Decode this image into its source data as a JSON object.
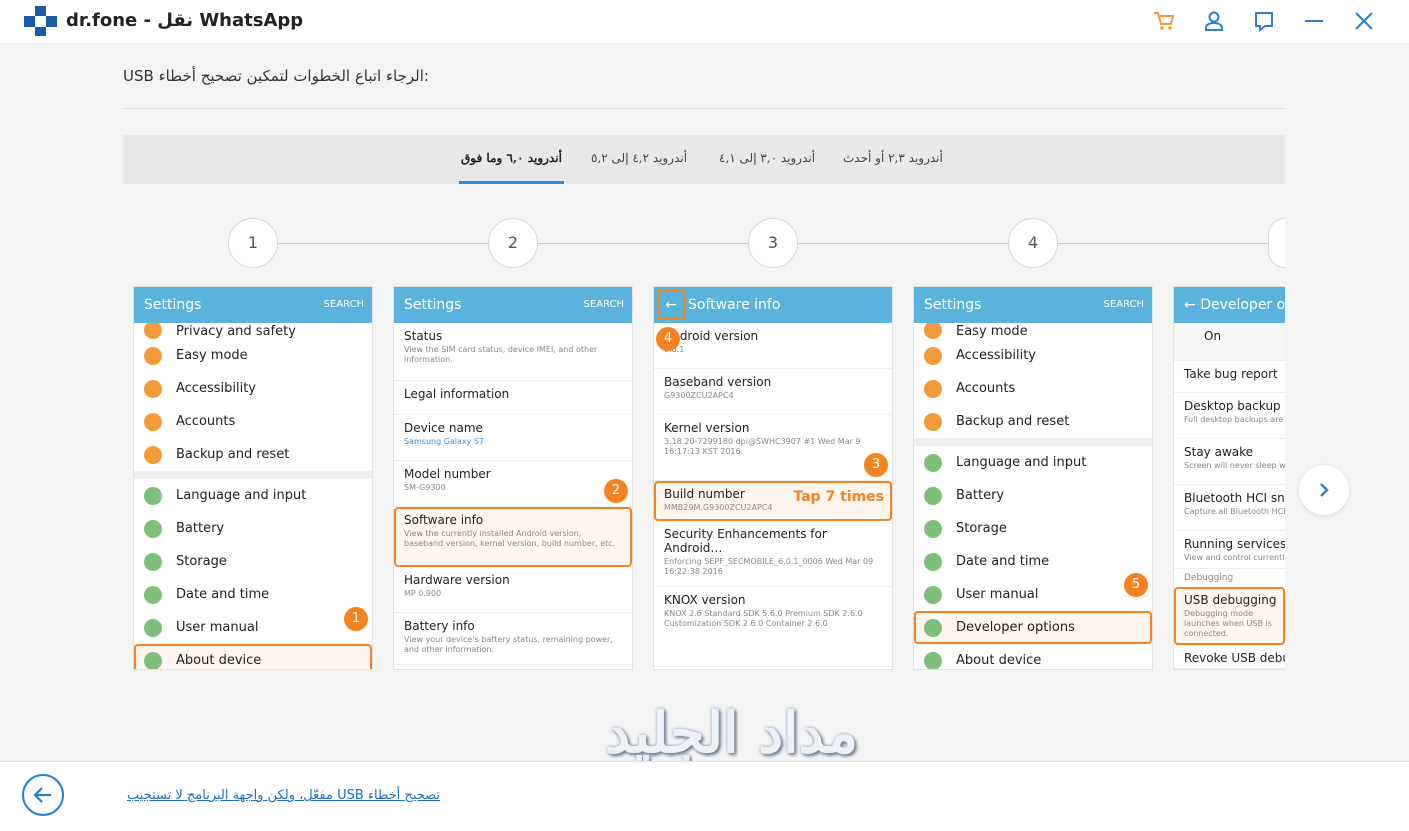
{
  "app": {
    "title": "dr.fone - نقل WhatsApp"
  },
  "window": {
    "icons": [
      "cart-icon",
      "user-icon",
      "feedback-icon",
      "minimize-icon",
      "close-icon"
    ]
  },
  "instruction": "USB الرجاء اتباع الخطوات لتمكين تصحيح أخطاء:",
  "tabs": [
    {
      "label": "أندرويد ٢,٣ أو أحدث"
    },
    {
      "label": "أندرويد ٣,٠ إلى ٤,١"
    },
    {
      "label": "أندرويد ٤,٢ إلى ٥,٢"
    },
    {
      "label": "أندرويد ٦,٠ وما فوق"
    }
  ],
  "steps": [
    "1",
    "2",
    "3",
    "4"
  ],
  "phone1": {
    "header": "Settings",
    "search": "SEARCH",
    "items": [
      "Privacy and safety",
      "Easy mode",
      "Accessibility",
      "Accounts",
      "Backup and reset",
      "Language and input",
      "Battery",
      "Storage",
      "Date and time",
      "User manual",
      "About device"
    ],
    "badge": "1"
  },
  "phone2": {
    "header": "Settings",
    "search": "SEARCH",
    "items": [
      {
        "title": "Status",
        "sub": "View the SIM card status, device IMEI, and other information."
      },
      {
        "title": "Legal information",
        "sub": ""
      },
      {
        "title": "Device name",
        "sub": "Samsung Galaxy S7"
      },
      {
        "title": "Model number",
        "sub": "SM-G9300"
      },
      {
        "title": "Software info",
        "sub": "View the currently installed Android version, baseband version, kernel version, build number, etc."
      },
      {
        "title": "Hardware version",
        "sub": "MP 0.900"
      },
      {
        "title": "Battery info",
        "sub": "View your device's battery status, remaining power, and other information."
      }
    ],
    "badge": "2"
  },
  "phone3": {
    "header": "Software info",
    "items": [
      {
        "title": "Android version",
        "sub": "6.0.1"
      },
      {
        "title": "Baseband version",
        "sub": "G9300ZCU2APC4"
      },
      {
        "title": "Kernel version",
        "sub": "3.18.20-7299180 dpi@SWHC3907 #1 Wed Mar 9 16:17:13 KST 2016"
      },
      {
        "title": "Build number",
        "sub": "MMB29M.G9300ZCU2APC4"
      },
      {
        "title": "Security Enhancements for Android…",
        "sub": "Enforcing SEPF_SECMOBILE_6.0.1_0006 Wed Mar 09 16:22:38 2016"
      },
      {
        "title": "KNOX version",
        "sub": "KNOX 2.6 Standard SDK 5.6.0 Premium SDK 2.6.0 Customization SDK 2.6.0 Container 2.6.0"
      }
    ],
    "tap": "Tap 7 times",
    "badge3": "3",
    "badge4": "4"
  },
  "phone4": {
    "header": "Settings",
    "search": "SEARCH",
    "items": [
      "Easy mode",
      "Accessibility",
      "Accounts",
      "Backup and reset",
      "Language and input",
      "Battery",
      "Storage",
      "Date and time",
      "User manual",
      "Developer options",
      "About device"
    ],
    "badge": "5"
  },
  "phone5": {
    "header": "Developer options",
    "on": "On",
    "items": [
      {
        "title": "Take bug report",
        "sub": ""
      },
      {
        "title": "Desktop backup password",
        "sub": "Full desktop backups are not currently protected"
      },
      {
        "title": "Stay awake",
        "sub": "Screen will never sleep while charging"
      },
      {
        "title": "Bluetooth HCI snoop log",
        "sub": "Capture all Bluetooth HCI packets in a file"
      },
      {
        "title": "Running services",
        "sub": "View and control currently running services"
      }
    ],
    "section": "Debugging",
    "usb": {
      "title": "USB debugging",
      "sub": "Debugging mode launches when USB is connected."
    },
    "revoke": "Revoke USB debugging authorizations"
  },
  "footer": {
    "link": "مفعّل، ولكن واجهة البرنامج لا تستجيب USB تصحيح أخطاء"
  },
  "watermark": "مداد الجليد",
  "colors": {
    "accent": "#f58220",
    "header": "#5ab3dc",
    "brand": "#1b5aa5",
    "link": "#1e6fc0"
  }
}
